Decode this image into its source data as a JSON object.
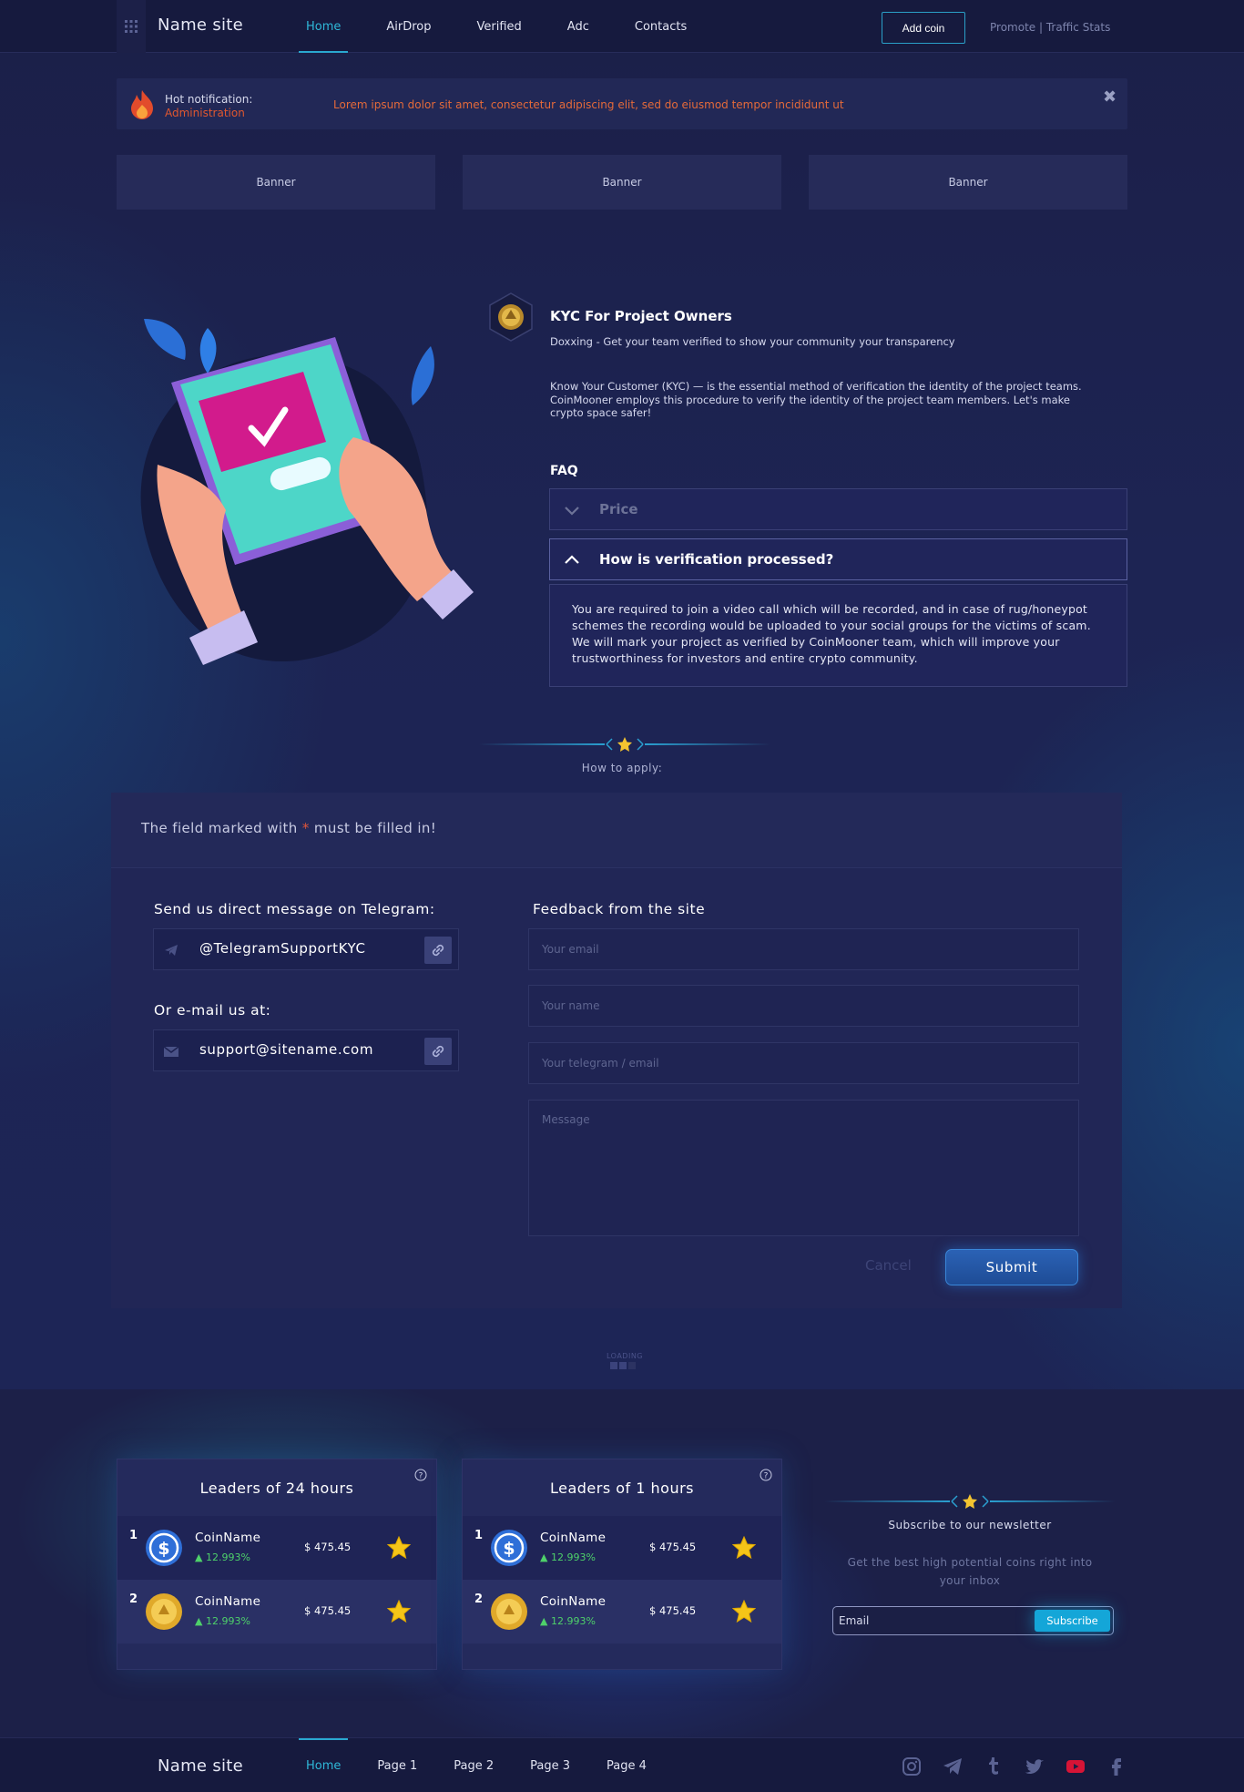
{
  "header": {
    "site_name": "Name site",
    "nav": [
      "Home",
      "AirDrop",
      "Verified",
      "Adc",
      "Contacts"
    ],
    "add_coin": "Add coin",
    "promote": "Promote | Traffic Stats"
  },
  "notification": {
    "title": "Hot notification:",
    "author": "Administration",
    "text": "Lorem ipsum dolor sit amet, consectetur adipiscing elit, sed do eiusmod tempor incididunt ut",
    "close": "✖"
  },
  "banners": [
    "Banner",
    "Banner",
    "Banner"
  ],
  "kyc": {
    "title": "KYC For Project Owners",
    "subtitle": "Doxxing - Get your team verified to show your community your transparency",
    "description": "Know Your Customer (KYC) — is the essential method of verification the identity of the project teams. CoinMooner employs this procedure to verify the identity of the project team members. Let's make crypto space safer!",
    "faq_title": "FAQ",
    "faq": [
      {
        "question": "Price",
        "open": false
      },
      {
        "question": "How is verification processed?",
        "open": true
      }
    ],
    "answer": "You are required to join a video call which will be recorded, and in case of rug/honeypot schemes the recording would be uploaded to your social groups for the victims of scam. We will mark your project as verified by CoinMooner team, which will improve your trustworthiness for investors and entire crypto community."
  },
  "how_to_apply": "How to apply:",
  "form": {
    "required_prefix": "The field marked with",
    "required_star": "*",
    "required_suffix": "must be filled in!",
    "telegram_label": "Send us direct message on Telegram:",
    "telegram_value": "@TelegramSupportKYC",
    "email_label": "Or e-mail us at:",
    "email_value": "support@sitename.com",
    "feedback_title": "Feedback from the site",
    "email_placeholder": "Your email",
    "name_placeholder": "Your name",
    "contact_placeholder": "Your telegram / email",
    "message_placeholder": "Message",
    "cancel": "Cancel",
    "submit": "Submit"
  },
  "loading": "LOADING",
  "leaders": [
    {
      "title": "Leaders of 24 hours",
      "rows": [
        {
          "rank": "1",
          "name": "CoinName",
          "change": "▲ 12.993%",
          "price": "$ 475.45",
          "icon": "dollar-coin-icon"
        },
        {
          "rank": "2",
          "name": "CoinName",
          "change": "▲ 12.993%",
          "price": "$ 475.45",
          "icon": "gold-coin-icon"
        }
      ]
    },
    {
      "title": "Leaders of 1 hours",
      "rows": [
        {
          "rank": "1",
          "name": "CoinName",
          "change": "▲ 12.993%",
          "price": "$ 475.45",
          "icon": "dollar-coin-icon"
        },
        {
          "rank": "2",
          "name": "CoinName",
          "change": "▲ 12.993%",
          "price": "$ 475.45",
          "icon": "gold-coin-icon"
        }
      ]
    }
  ],
  "newsletter": {
    "title": "Subscribe to our newsletter",
    "description": "Get the best high potential coins right into your inbox",
    "placeholder": "Email",
    "button": "Subscribe"
  },
  "footer": {
    "site_name": "Name site",
    "nav": [
      "Home",
      "Page 1",
      "Page 2",
      "Page 3",
      "Page 4"
    ],
    "socials": [
      "instagram-icon",
      "telegram-icon",
      "tumblr-icon",
      "twitter-icon",
      "youtube-icon",
      "facebook-icon"
    ]
  },
  "colors": {
    "accent": "#2aa8d0",
    "alert": "#e46a3a",
    "positive": "#4ed16a",
    "submit": "#2b62b5"
  }
}
